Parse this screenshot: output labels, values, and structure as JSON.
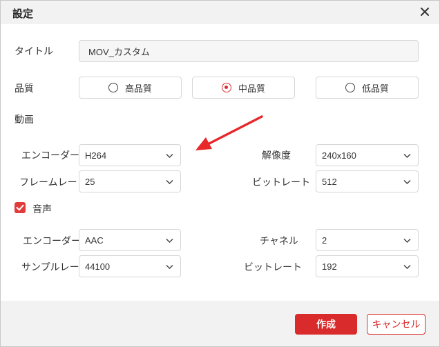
{
  "dialog": {
    "title": "設定"
  },
  "title_row": {
    "label": "タイトル",
    "value": "MOV_カスタム"
  },
  "quality": {
    "label": "品質",
    "options": [
      "高品質",
      "中品質",
      "低品質"
    ],
    "selected": "中品質"
  },
  "video": {
    "section_label": "動画",
    "encoder_label": "エンコーダー",
    "encoder_value": "H264",
    "resolution_label": "解像度",
    "resolution_value": "240x160",
    "framerate_label": "フレームレート",
    "framerate_value": "25",
    "bitrate_label": "ビットレート",
    "bitrate_value": "512"
  },
  "audio": {
    "section_label": "音声",
    "enabled": true,
    "encoder_label": "エンコーダー",
    "encoder_value": "AAC",
    "channel_label": "チャネル",
    "channel_value": "2",
    "samplerate_label": "サンプルレート",
    "samplerate_value": "44100",
    "bitrate_label": "ビットレート",
    "bitrate_value": "192"
  },
  "buttons": {
    "create": "作成",
    "cancel": "キャンセル"
  },
  "colors": {
    "accent": "#d92b2b",
    "annotation_arrow": "#e8272a"
  }
}
